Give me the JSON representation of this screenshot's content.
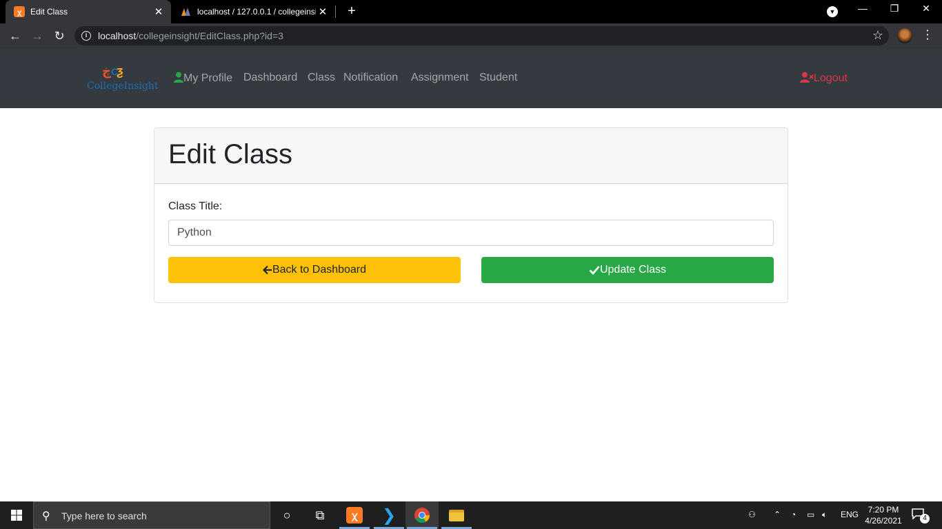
{
  "browser": {
    "tabs": [
      {
        "title": "Edit Class",
        "active": true
      },
      {
        "title": "localhost / 127.0.0.1 / collegeinsight",
        "active": false
      }
    ],
    "url_host": "localhost",
    "url_path": "/collegeinsight/EditClass.php?id=3"
  },
  "navbar": {
    "brand": "CollegeInsight",
    "items": [
      {
        "label": "My Profile",
        "icon": "user-icon"
      },
      {
        "label": "Dashboard"
      },
      {
        "label": "Class"
      },
      {
        "label": "Notification"
      },
      {
        "label": "Assignment"
      },
      {
        "label": "Student"
      }
    ],
    "logout": "Logout"
  },
  "form": {
    "heading": "Edit Class",
    "label": "Class Title:",
    "value": "Python",
    "back_button": "Back to Dashboard",
    "update_button": "Update Class"
  },
  "taskbar": {
    "search_placeholder": "Type here to search",
    "language": "ENG",
    "time": "7:20 PM",
    "date": "4/26/2021",
    "notification_count": "4"
  },
  "colors": {
    "navbar_bg": "#343a40",
    "warning": "#ffc107",
    "success": "#28a745",
    "danger": "#dc3545"
  }
}
